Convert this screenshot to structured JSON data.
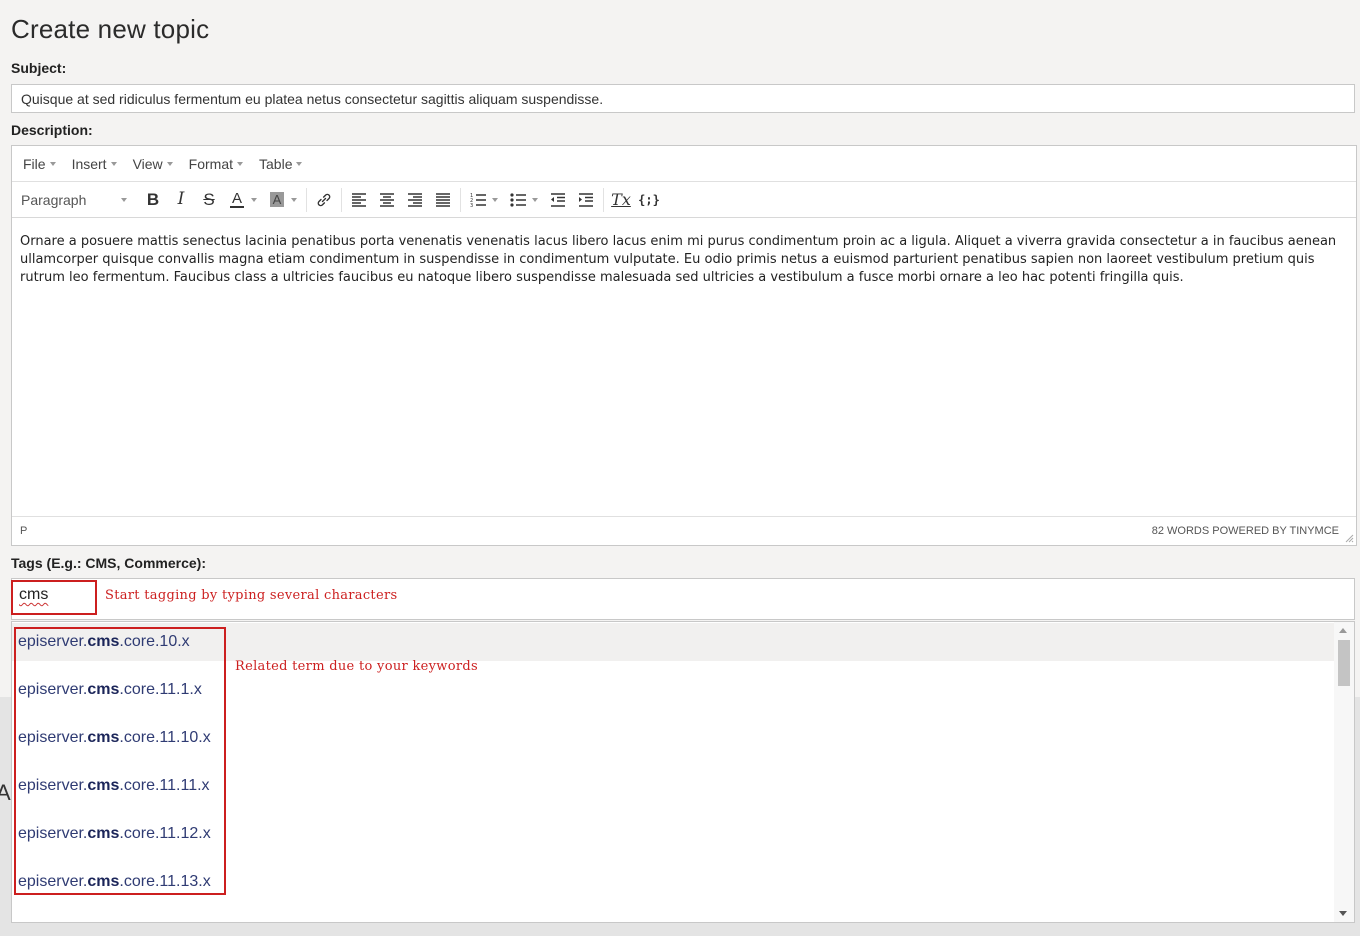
{
  "page": {
    "title": "Create new topic"
  },
  "subject": {
    "label": "Subject:",
    "value": "Quisque at sed ridiculus fermentum eu platea netus consectetur sagittis aliquam suspendisse."
  },
  "description": {
    "label": "Description:",
    "menubar": [
      "File",
      "Insert",
      "View",
      "Format",
      "Table"
    ],
    "toolbar": {
      "format_select": "Paragraph",
      "bold": "B",
      "italic": "I",
      "strikethrough": "S",
      "text_color": "A",
      "background_color": "A",
      "clear_formatting": "Tx",
      "source_code": "{;}"
    },
    "content": "Ornare a posuere mattis senectus lacinia penatibus porta venenatis venenatis lacus libero lacus enim mi purus condimentum proin ac a ligula. Aliquet a viverra gravida consectetur a in faucibus aenean ullamcorper quisque convallis magna etiam condimentum in suspendisse in condimentum vulputate. Eu odio primis netus a euismod parturient penatibus sapien non laoreet vestibulum pretium quis rutrum leo fermentum. Faucibus class a ultricies faucibus eu natoque libero suspendisse malesuada sed ultricies a vestibulum a fusce morbi ornare a leo hac potenti fringilla quis.",
    "status_path": "P",
    "word_count": "82 WORDS POWERED BY TINYMCE"
  },
  "tags": {
    "label": "Tags (E.g.: CMS, Commerce):",
    "input_value": "cms",
    "hint": "Start tagging by typing several characters",
    "related_note": "Related term due to your keywords",
    "suggestions": [
      {
        "prefix": "episerver.",
        "match": "cms",
        "suffix": ".core.10.x"
      },
      {
        "prefix": "episerver.",
        "match": "cms",
        "suffix": ".core.11.1.x"
      },
      {
        "prefix": "episerver.",
        "match": "cms",
        "suffix": ".core.11.10.x"
      },
      {
        "prefix": "episerver.",
        "match": "cms",
        "suffix": ".core.11.11.x"
      },
      {
        "prefix": "episerver.",
        "match": "cms",
        "suffix": ".core.11.12.x"
      },
      {
        "prefix": "episerver.",
        "match": "cms",
        "suffix": ".core.11.13.x"
      }
    ]
  },
  "colors": {
    "highlight": "#cc1f1f",
    "link": "#2f3b73"
  },
  "background": {
    "partial_glyph": "A"
  }
}
